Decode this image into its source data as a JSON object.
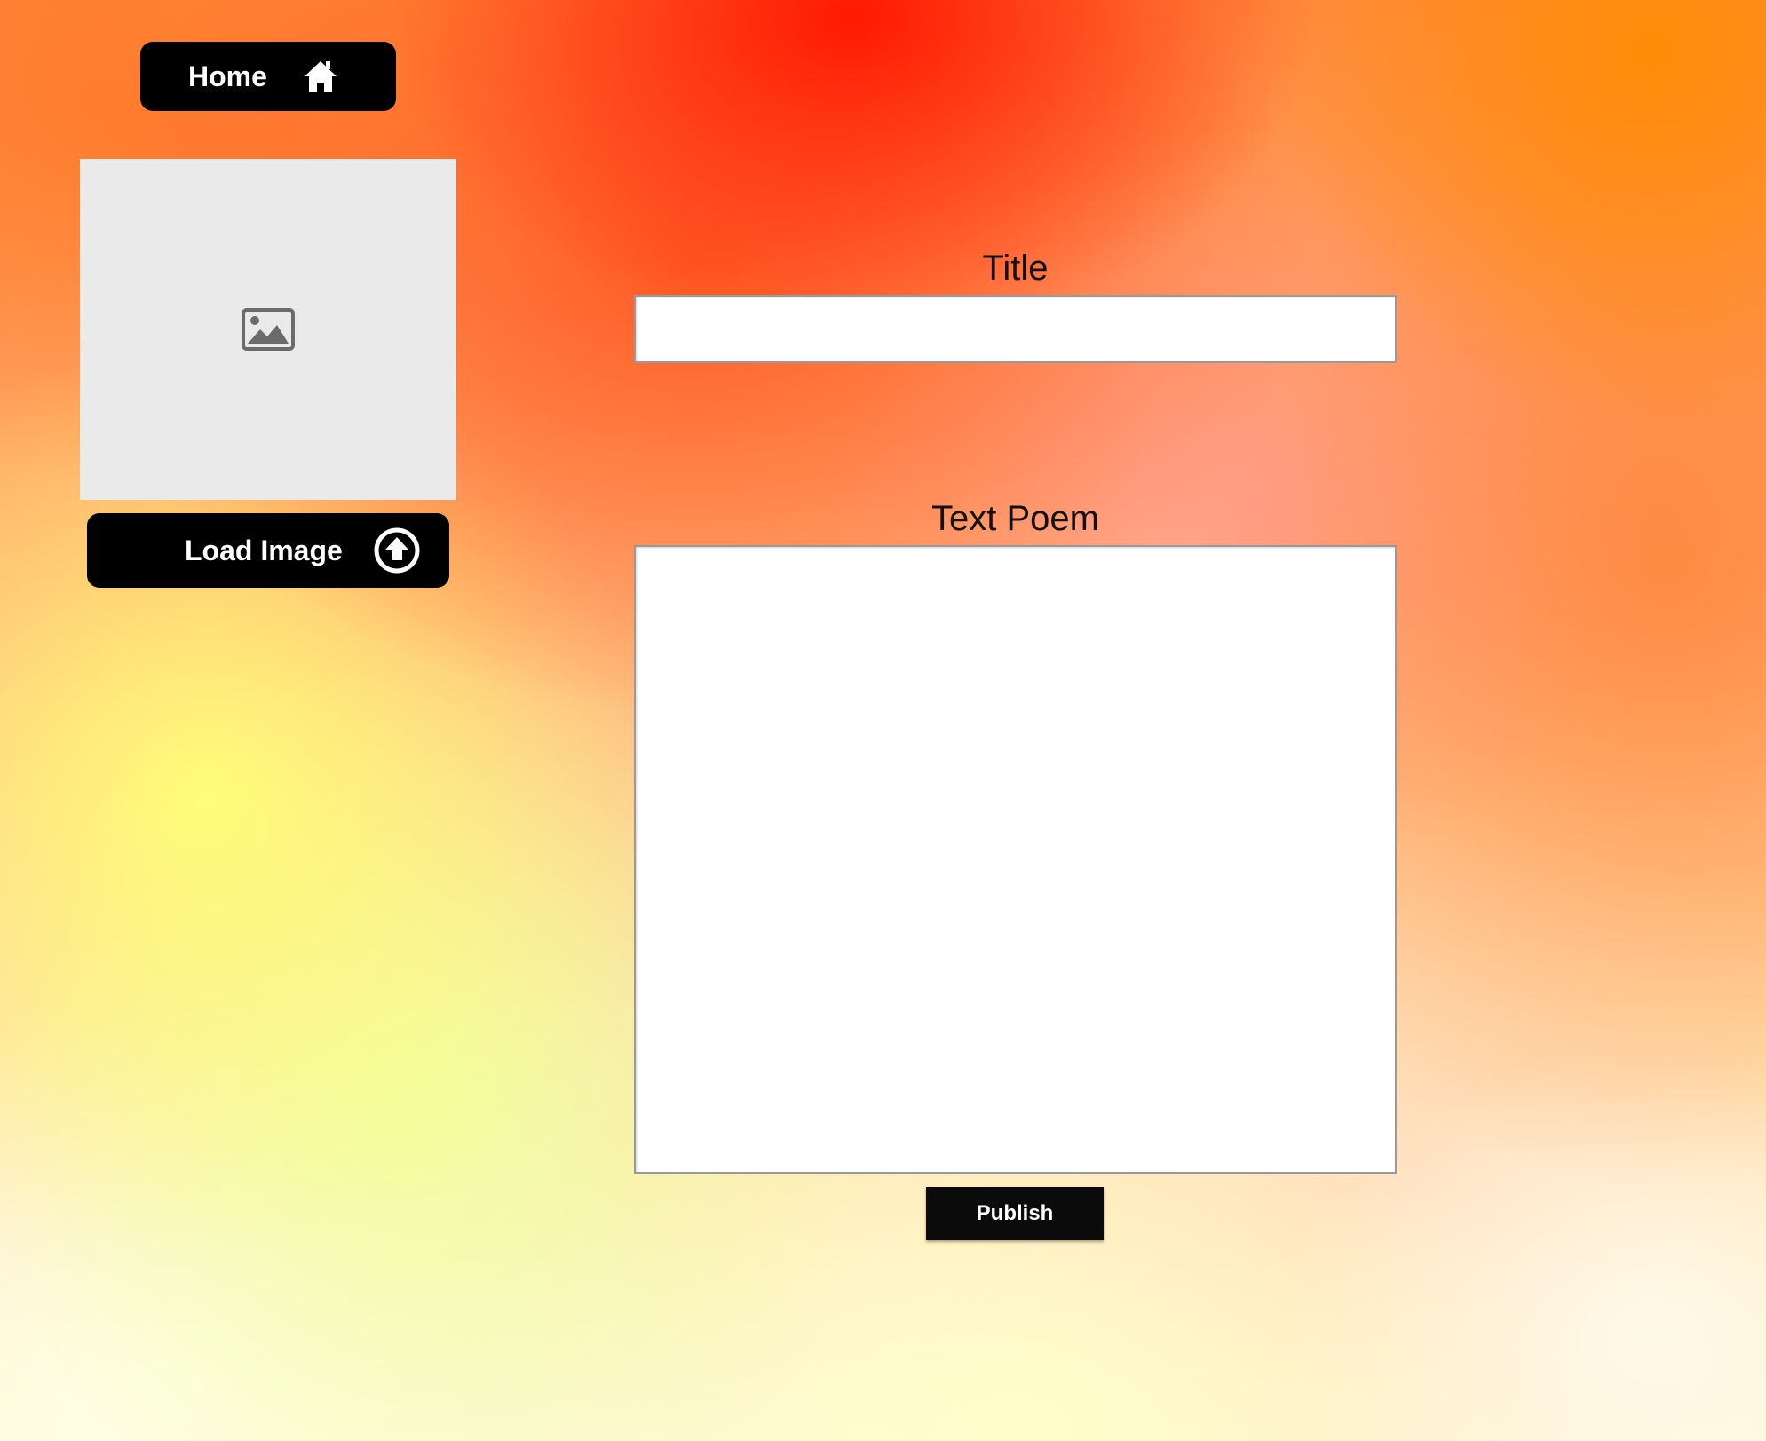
{
  "nav": {
    "home_label": "Home",
    "home_icon": "home-icon"
  },
  "image_panel": {
    "placeholder_icon": "image-icon",
    "load_label": "Load Image",
    "load_icon": "upload-icon"
  },
  "form": {
    "title_label": "Title",
    "title_value": "",
    "poem_label": "Text Poem",
    "poem_value": "",
    "publish_label": "Publish"
  },
  "colors": {
    "button_bg": "#000000",
    "button_text": "#ffffff",
    "placeholder_bg": "#eaeaea"
  }
}
